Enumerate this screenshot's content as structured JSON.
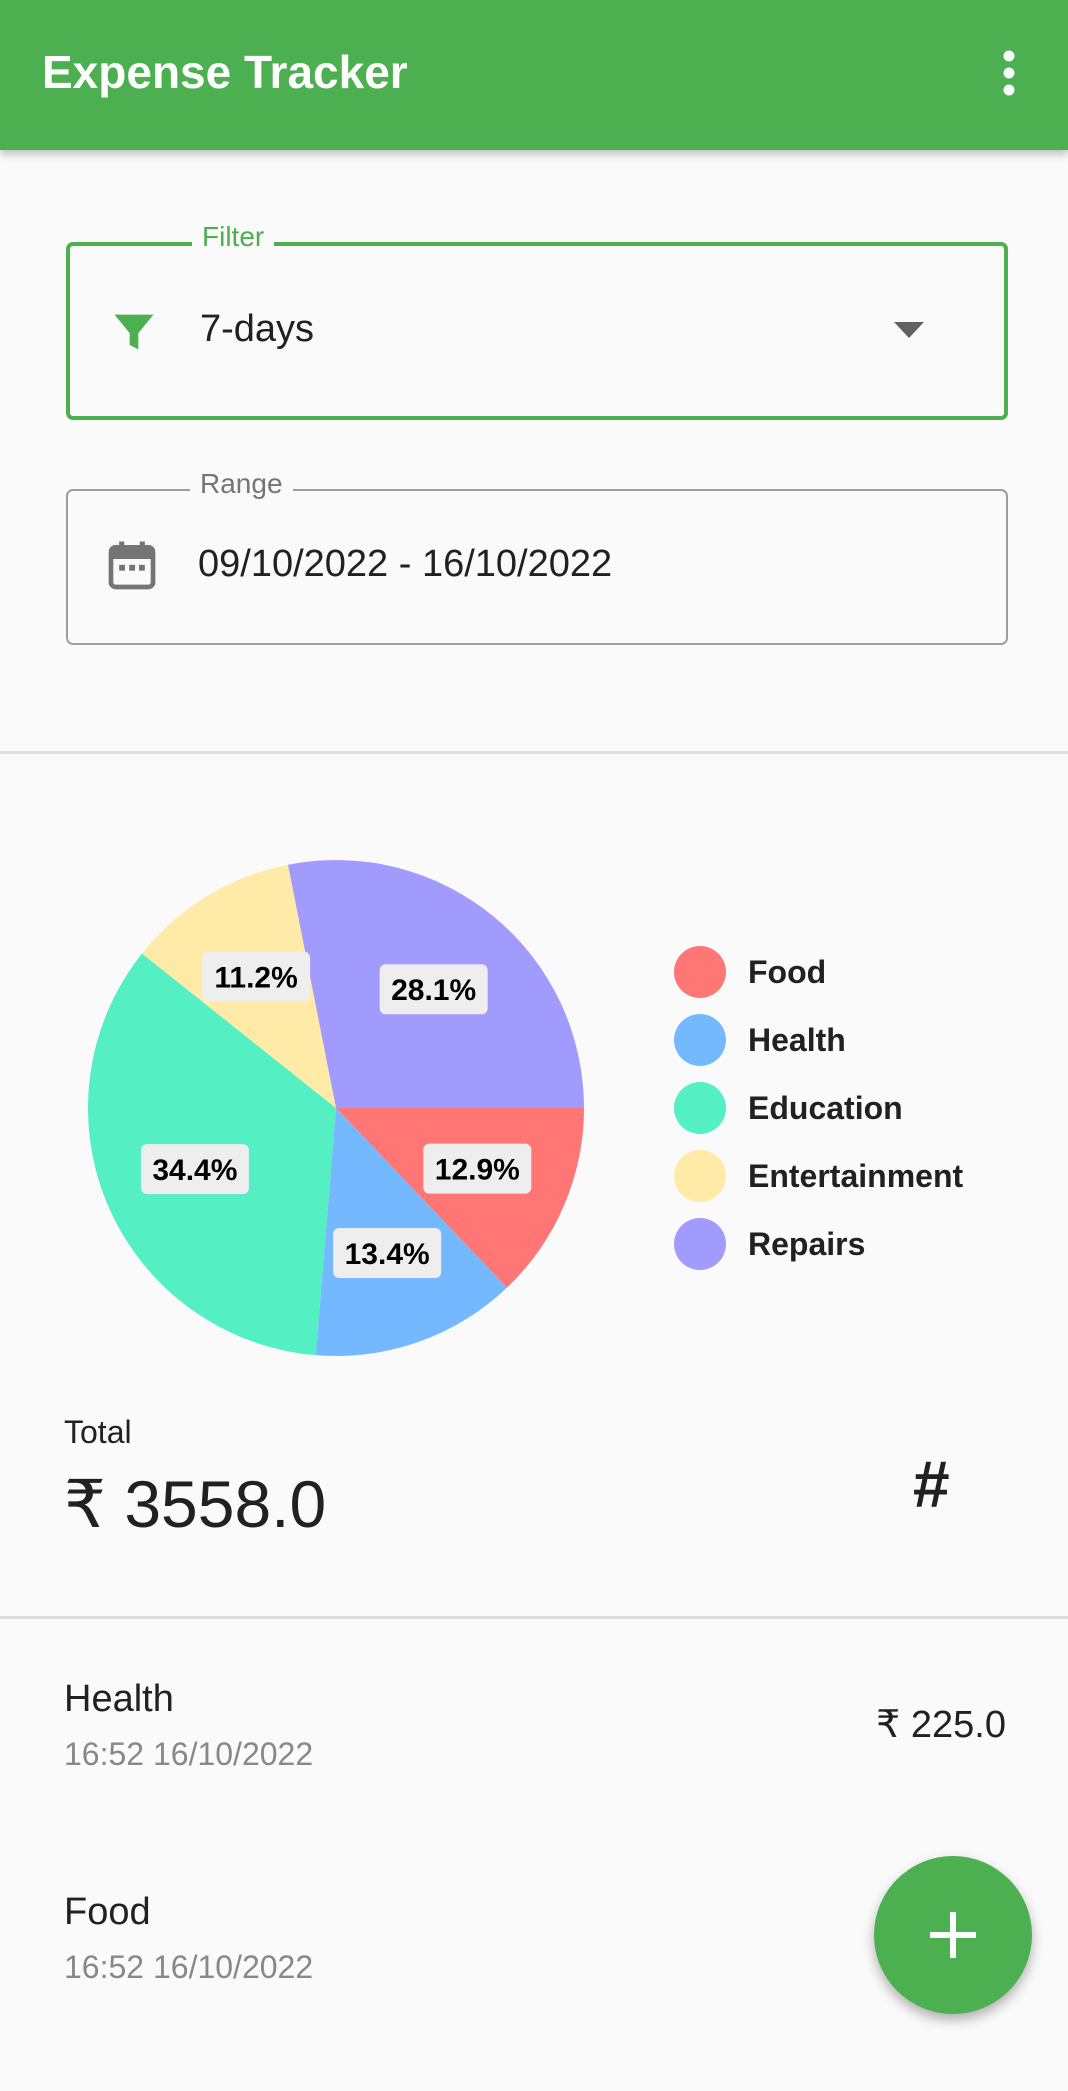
{
  "app_bar": {
    "title": "Expense Tracker",
    "menu_icon": "more-vert-icon"
  },
  "filter": {
    "label": "Filter",
    "value": "7-days",
    "icon": "filter-icon",
    "dropdown_icon": "arrow-drop-down-icon"
  },
  "range": {
    "label": "Range",
    "value": "09/10/2022 - 16/10/2022",
    "icon": "calendar-icon"
  },
  "chart_data": {
    "type": "pie",
    "categories": [
      "Food",
      "Health",
      "Education",
      "Entertainment",
      "Repairs"
    ],
    "values": [
      12.9,
      13.4,
      34.4,
      11.2,
      28.1
    ],
    "labels": [
      "12.9%",
      "13.4%",
      "34.4%",
      "11.2%",
      "28.1%"
    ],
    "colors": [
      "#ff7675",
      "#74b9ff",
      "#55efc4",
      "#ffeaa7",
      "#a29bfe"
    ],
    "legend_position": "right"
  },
  "total": {
    "label": "Total",
    "value": "₹ 3558.0",
    "icon": "hash-icon"
  },
  "transactions": [
    {
      "category": "Health",
      "time": "16:52 16/10/2022",
      "amount": "₹ 225.0"
    },
    {
      "category": "Food",
      "time": "16:52 16/10/2022",
      "amount": ""
    }
  ],
  "fab": {
    "icon": "add-icon",
    "color": "#4caf50"
  },
  "accent_color": "#4caf50"
}
